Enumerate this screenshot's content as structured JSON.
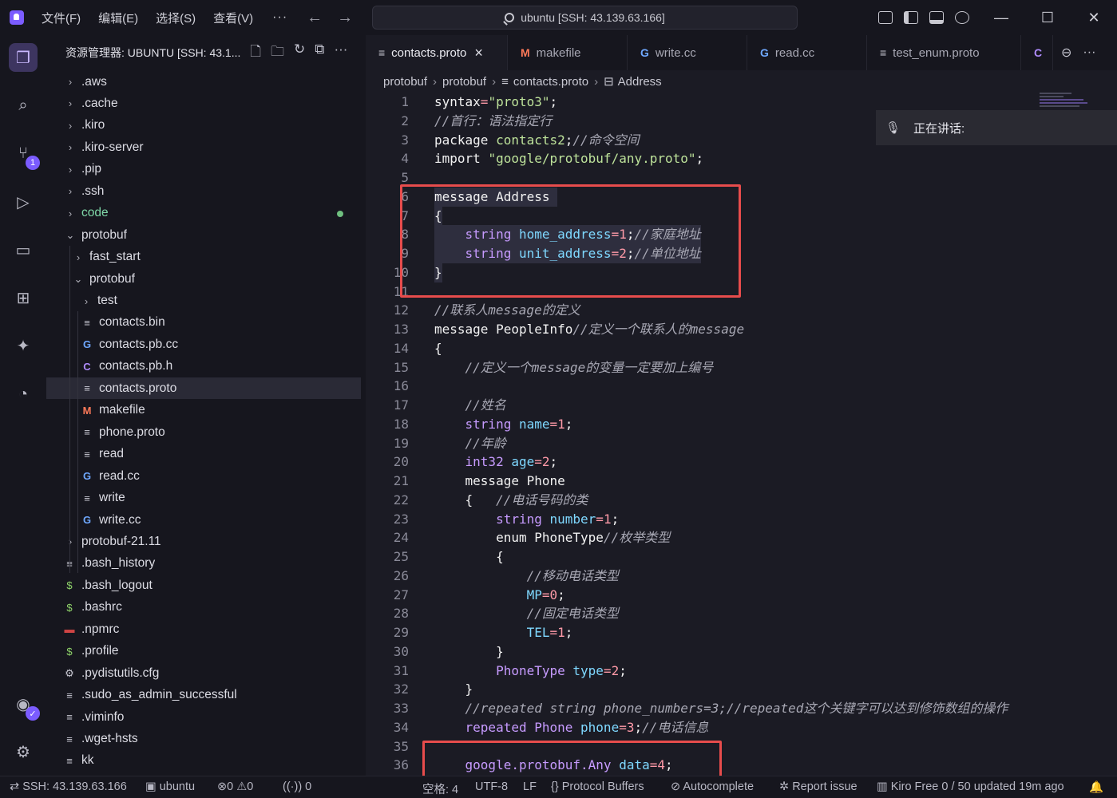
{
  "titlebar": {
    "menus": [
      "文件(F)",
      "编辑(E)",
      "选择(S)",
      "查看(V)"
    ],
    "more": "···",
    "search_text": "ubuntu [SSH: 43.139.63.166]"
  },
  "sidebar": {
    "title": "资源管理器: UBUNTU [SSH: 43.1...",
    "tree": [
      {
        "label": ".aws",
        "kind": "folder",
        "indent": 0
      },
      {
        "label": ".cache",
        "kind": "folder",
        "indent": 0
      },
      {
        "label": ".kiro",
        "kind": "folder",
        "indent": 0
      },
      {
        "label": ".kiro-server",
        "kind": "folder",
        "indent": 0
      },
      {
        "label": ".pip",
        "kind": "folder",
        "indent": 0
      },
      {
        "label": ".ssh",
        "kind": "folder",
        "indent": 0
      },
      {
        "label": "code",
        "kind": "folder",
        "indent": 0,
        "color": "#7fd8a8",
        "dot": true
      },
      {
        "label": "protobuf",
        "kind": "folder-open",
        "indent": 0
      },
      {
        "label": "fast_start",
        "kind": "folder",
        "indent": 1
      },
      {
        "label": "protobuf",
        "kind": "folder-open",
        "indent": 1
      },
      {
        "label": "test",
        "kind": "folder",
        "indent": 2
      },
      {
        "label": "contacts.bin",
        "kind": "text",
        "indent": 2
      },
      {
        "label": "contacts.pb.cc",
        "kind": "cpp",
        "indent": 2
      },
      {
        "label": "contacts.pb.h",
        "kind": "c",
        "indent": 2
      },
      {
        "label": "contacts.proto",
        "kind": "text",
        "indent": 2,
        "selected": true
      },
      {
        "label": "makefile",
        "kind": "make",
        "indent": 2
      },
      {
        "label": "phone.proto",
        "kind": "text",
        "indent": 2
      },
      {
        "label": "read",
        "kind": "text",
        "indent": 2
      },
      {
        "label": "read.cc",
        "kind": "cpp",
        "indent": 2
      },
      {
        "label": "write",
        "kind": "text",
        "indent": 2
      },
      {
        "label": "write.cc",
        "kind": "cpp",
        "indent": 2
      },
      {
        "label": "protobuf-21.11",
        "kind": "folder",
        "indent": 0
      },
      {
        "label": ".bash_history",
        "kind": "text",
        "indent": 0
      },
      {
        "label": ".bash_logout",
        "kind": "shell",
        "indent": 0
      },
      {
        "label": ".bashrc",
        "kind": "shell",
        "indent": 0
      },
      {
        "label": ".npmrc",
        "kind": "npm",
        "indent": 0
      },
      {
        "label": ".profile",
        "kind": "shell",
        "indent": 0
      },
      {
        "label": ".pydistutils.cfg",
        "kind": "gear",
        "indent": 0
      },
      {
        "label": ".sudo_as_admin_successful",
        "kind": "text",
        "indent": 0
      },
      {
        "label": ".viminfo",
        "kind": "text",
        "indent": 0
      },
      {
        "label": ".wget-hsts",
        "kind": "text",
        "indent": 0
      },
      {
        "label": "kk",
        "kind": "text",
        "indent": 0
      }
    ]
  },
  "tabs": [
    {
      "label": "contacts.proto",
      "icon": "text",
      "active": true,
      "close": "×"
    },
    {
      "label": "makefile",
      "icon": "make"
    },
    {
      "label": "write.cc",
      "icon": "cpp"
    },
    {
      "label": "read.cc",
      "icon": "cpp"
    },
    {
      "label": "test_enum.proto",
      "icon": "text"
    },
    {
      "label": "",
      "icon": "c"
    }
  ],
  "breadcrumb": [
    "protobuf",
    "protobuf",
    "contacts.proto",
    "Address"
  ],
  "speaking": {
    "label": "正在讲话:"
  },
  "code": [
    [
      [
        "kw",
        "syntax"
      ],
      [
        "op",
        "="
      ],
      [
        "str",
        "\"proto3\""
      ],
      [
        "kw",
        ";"
      ]
    ],
    [
      [
        "cm",
        "//首行：语法指定行"
      ]
    ],
    [
      [
        "kw",
        "package "
      ],
      [
        "str",
        "contacts2"
      ],
      [
        "kw",
        ";"
      ],
      [
        "cm",
        "//命令空间"
      ]
    ],
    [
      [
        "kw",
        "import "
      ],
      [
        "str",
        "\"google/protobuf/any.proto\""
      ],
      [
        "kw",
        ";"
      ]
    ],
    [],
    [
      [
        "kw",
        "message Address "
      ]
    ],
    [
      [
        "kw",
        "{"
      ]
    ],
    [
      [
        "kw",
        "    "
      ],
      [
        "ty",
        "string "
      ],
      [
        "fd",
        "home_address"
      ],
      [
        "op",
        "="
      ],
      [
        "num",
        "1"
      ],
      [
        "kw",
        ";"
      ],
      [
        "cm",
        "//家庭地址"
      ]
    ],
    [
      [
        "kw",
        "    "
      ],
      [
        "ty",
        "string "
      ],
      [
        "fd",
        "unit_address"
      ],
      [
        "op",
        "="
      ],
      [
        "num",
        "2"
      ],
      [
        "kw",
        ";"
      ],
      [
        "cm",
        "//单位地址"
      ]
    ],
    [
      [
        "kw",
        "}"
      ]
    ],
    [],
    [
      [
        "cm",
        "//联系人message的定义"
      ]
    ],
    [
      [
        "kw",
        "message PeopleInfo"
      ],
      [
        "cm",
        "//定义一个联系人的message"
      ]
    ],
    [
      [
        "kw",
        "{"
      ]
    ],
    [
      [
        "kw",
        "    "
      ],
      [
        "cm",
        "//定义一个message的变量一定要加上编号"
      ]
    ],
    [],
    [
      [
        "kw",
        "    "
      ],
      [
        "cm",
        "//姓名"
      ]
    ],
    [
      [
        "kw",
        "    "
      ],
      [
        "ty",
        "string "
      ],
      [
        "fd",
        "name"
      ],
      [
        "op",
        "="
      ],
      [
        "num",
        "1"
      ],
      [
        "kw",
        ";"
      ]
    ],
    [
      [
        "kw",
        "    "
      ],
      [
        "cm",
        "//年龄"
      ]
    ],
    [
      [
        "kw",
        "    "
      ],
      [
        "ty",
        "int32 "
      ],
      [
        "fd",
        "age"
      ],
      [
        "op",
        "="
      ],
      [
        "num",
        "2"
      ],
      [
        "kw",
        ";"
      ]
    ],
    [
      [
        "kw",
        "    message Phone"
      ]
    ],
    [
      [
        "kw",
        "    {   "
      ],
      [
        "cm",
        "//电话号码的类"
      ]
    ],
    [
      [
        "kw",
        "        "
      ],
      [
        "ty",
        "string "
      ],
      [
        "fd",
        "number"
      ],
      [
        "op",
        "="
      ],
      [
        "num",
        "1"
      ],
      [
        "kw",
        ";"
      ]
    ],
    [
      [
        "kw",
        "        enum PhoneType"
      ],
      [
        "cm",
        "//枚举类型"
      ]
    ],
    [
      [
        "kw",
        "        {"
      ]
    ],
    [
      [
        "kw",
        "            "
      ],
      [
        "cm",
        "//移动电话类型"
      ]
    ],
    [
      [
        "kw",
        "            "
      ],
      [
        "fd",
        "MP"
      ],
      [
        "op",
        "="
      ],
      [
        "num",
        "0"
      ],
      [
        "kw",
        ";"
      ]
    ],
    [
      [
        "kw",
        "            "
      ],
      [
        "cm",
        "//固定电话类型"
      ]
    ],
    [
      [
        "kw",
        "            "
      ],
      [
        "fd",
        "TEL"
      ],
      [
        "op",
        "="
      ],
      [
        "num",
        "1"
      ],
      [
        "kw",
        ";"
      ]
    ],
    [
      [
        "kw",
        "        }"
      ]
    ],
    [
      [
        "kw",
        "        "
      ],
      [
        "ty",
        "PhoneType "
      ],
      [
        "fd",
        "type"
      ],
      [
        "op",
        "="
      ],
      [
        "num",
        "2"
      ],
      [
        "kw",
        ";"
      ]
    ],
    [
      [
        "kw",
        "    }"
      ]
    ],
    [
      [
        "kw",
        "    "
      ],
      [
        "cm",
        "//repeated string phone_numbers=3;//repeated这个关键字可以达到修饰数组的操作"
      ]
    ],
    [
      [
        "kw",
        "    "
      ],
      [
        "ty",
        "repeated Phone "
      ],
      [
        "fd",
        "phone"
      ],
      [
        "op",
        "="
      ],
      [
        "num",
        "3"
      ],
      [
        "kw",
        ";"
      ],
      [
        "cm",
        "//电话信息"
      ]
    ],
    [],
    [
      [
        "kw",
        "    "
      ],
      [
        "ty",
        "google.protobuf.Any "
      ],
      [
        "fd",
        "data"
      ],
      [
        "op",
        "="
      ],
      [
        "num",
        "4"
      ],
      [
        "kw",
        ";"
      ]
    ]
  ],
  "status": {
    "remote": "SSH: 43.139.63.166",
    "profile": "ubuntu",
    "errors": "0",
    "warnings": "0",
    "ports": "0",
    "indent": "空格: 4",
    "encoding": "UTF-8",
    "eol": "LF",
    "language": "Protocol Buffers",
    "autocomplete": "Autocomplete",
    "report": "Report issue",
    "kiro": "Kiro Free 0 / 50 updated 19m ago"
  },
  "activity_badge": "1"
}
